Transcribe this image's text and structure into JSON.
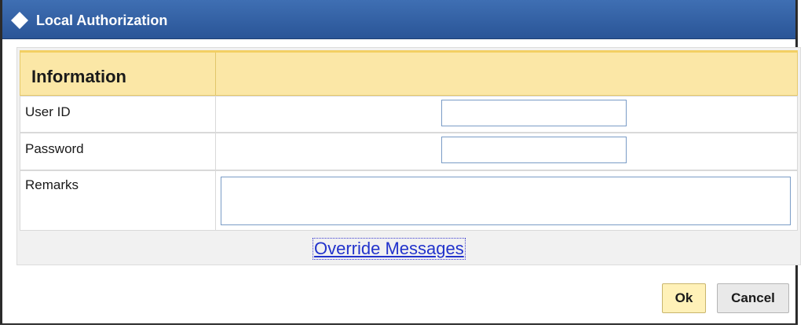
{
  "window": {
    "title": "Local Authorization",
    "title_icon": "diamond-icon"
  },
  "section": {
    "title": "Information"
  },
  "fields": {
    "user_id_label": "User ID",
    "user_id_value": "",
    "password_label": "Password",
    "password_value": "",
    "remarks_label": "Remarks",
    "remarks_value": ""
  },
  "link": {
    "override_messages": "Override Messages"
  },
  "buttons": {
    "ok": "Ok",
    "cancel": "Cancel"
  },
  "colors": {
    "titlebar": "#2f5fa5",
    "header_fill": "#fbe7a6",
    "link": "#2233cc",
    "ok_button": "#fff1b8"
  }
}
